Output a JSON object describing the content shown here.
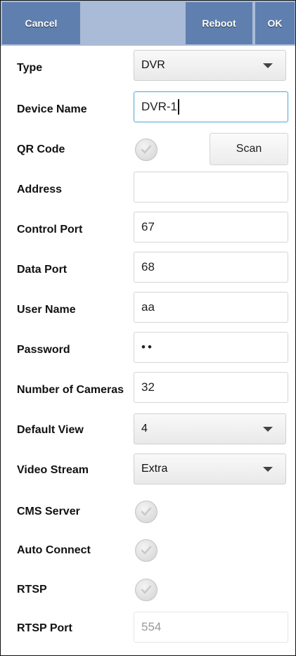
{
  "header": {
    "cancel_label": "Cancel",
    "reboot_label": "Reboot",
    "ok_label": "OK"
  },
  "form": {
    "type": {
      "label": "Type",
      "value": "DVR"
    },
    "device_name": {
      "label": "Device Name",
      "value": "DVR-1"
    },
    "qr_code": {
      "label": "QR Code",
      "scan_label": "Scan",
      "checked": false
    },
    "address": {
      "label": "Address",
      "value": ""
    },
    "control_port": {
      "label": "Control Port",
      "value": "67"
    },
    "data_port": {
      "label": "Data Port",
      "value": "68"
    },
    "user_name": {
      "label": "User Name",
      "value": "aa"
    },
    "password": {
      "label": "Password",
      "value": "••"
    },
    "number_of_cameras": {
      "label": "Number of Cameras",
      "value": "32"
    },
    "default_view": {
      "label": "Default View",
      "value": "4"
    },
    "video_stream": {
      "label": "Video Stream",
      "value": "Extra"
    },
    "cms_server": {
      "label": "CMS Server",
      "checked": false
    },
    "auto_connect": {
      "label": "Auto Connect",
      "checked": false
    },
    "rtsp": {
      "label": "RTSP",
      "checked": false
    },
    "rtsp_port": {
      "label": "RTSP Port",
      "value": "554"
    }
  },
  "colors": {
    "header_bg": "#a9bbd6",
    "button_bg": "#5f7faf",
    "focus_border": "#4aa8d8"
  },
  "icons": {
    "dropdown": "caret-down-icon",
    "checkbox": "check-icon"
  }
}
